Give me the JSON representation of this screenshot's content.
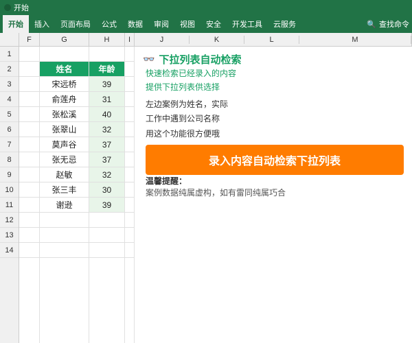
{
  "titlebar": {
    "dot": "",
    "text": "开始"
  },
  "ribbon": {
    "tabs": [
      "开始",
      "插入",
      "页面布局",
      "公式",
      "数据",
      "审阅",
      "视图",
      "安全",
      "开发工具",
      "云服务"
    ],
    "active_tab": "开始",
    "search_placeholder": "查找命令"
  },
  "columns": {
    "headers": [
      "F",
      "G",
      "H",
      "I",
      "J",
      "K",
      "L",
      "M"
    ]
  },
  "rows": {
    "numbers": [
      1,
      2,
      3,
      4,
      5,
      6,
      7,
      8,
      9,
      10,
      11,
      12,
      13,
      14
    ]
  },
  "table": {
    "header": [
      "姓名",
      "年龄"
    ],
    "data": [
      [
        "宋远桥",
        "39"
      ],
      [
        "俞莲舟",
        "31"
      ],
      [
        "张松溪",
        "40"
      ],
      [
        "张翠山",
        "32"
      ],
      [
        "莫声谷",
        "37"
      ],
      [
        "张无忌",
        "37"
      ],
      [
        "赵敏",
        "32"
      ],
      [
        "张三丰",
        "30"
      ],
      [
        "谢逊",
        "39"
      ]
    ]
  },
  "info_panel": {
    "title": "下拉列表自动检索",
    "glasses": "👓",
    "sub_lines": [
      "快速检索已经录入的内容",
      "提供下拉列表供选择"
    ],
    "desc_lines": [
      "左边案例为姓名，实际",
      "工作中遇到公司名称",
      "用这个功能很方便哦"
    ],
    "button_label": "录入内容自动检索下拉列表",
    "reminder_title": "温馨提醒：",
    "reminder_text": "案例数据纯属虚构，如有雷同纯属巧合"
  }
}
